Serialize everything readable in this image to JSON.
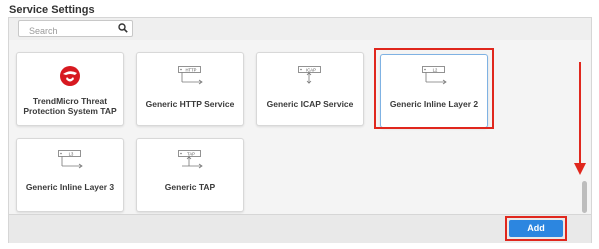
{
  "section": {
    "title": "Service Settings"
  },
  "search": {
    "placeholder": "Search",
    "value": ""
  },
  "tiles": [
    {
      "label": "TrendMicro Threat Protection System TAP",
      "icon": "trendmicro-logo-icon"
    },
    {
      "label": "Generic HTTP Service",
      "icon": "http-service-icon",
      "icon_text": "HTTP"
    },
    {
      "label": "Generic ICAP Service",
      "icon": "icap-service-icon",
      "icon_text": "ICAP"
    },
    {
      "label": "Generic Inline Layer 2",
      "icon": "inline-layer2-icon",
      "icon_text": "L2",
      "selected": true
    },
    {
      "label": "Generic Inline Layer 3",
      "icon": "inline-layer3-icon",
      "icon_text": "L3"
    },
    {
      "label": "Generic TAP",
      "icon": "tap-icon",
      "icon_text": "TAP"
    }
  ],
  "footer": {
    "add_label": "Add"
  },
  "colors": {
    "accent": "#2c86e0",
    "annotation_red": "#e0271d",
    "trendmicro_red": "#d71920",
    "selected_border": "#7fb2e3"
  }
}
